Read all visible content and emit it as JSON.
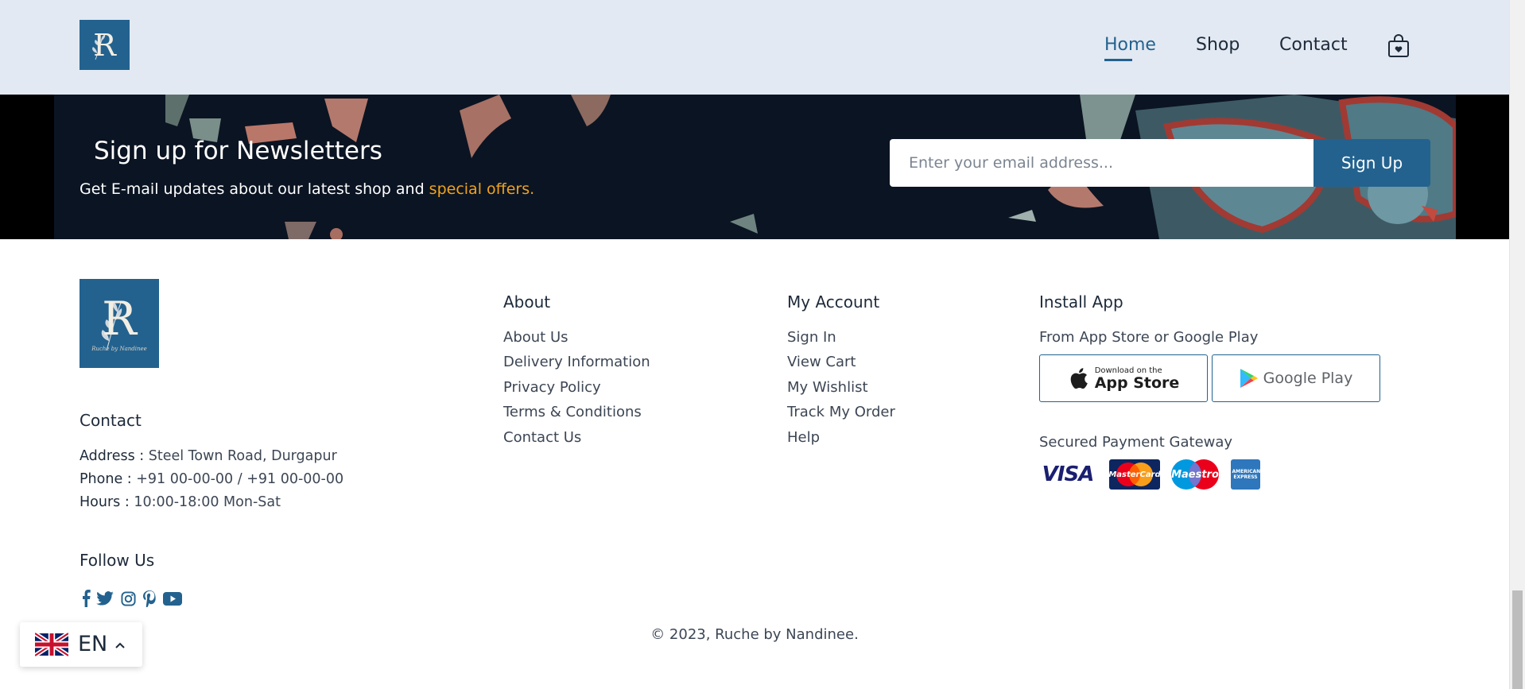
{
  "brand": {
    "logo_letter": "R",
    "logo_caption": "Ruche by Nandinee"
  },
  "nav": {
    "items": [
      "Home",
      "Shop",
      "Contact"
    ],
    "active": "Home"
  },
  "newsletter": {
    "title": "Sign up for Newsletters",
    "subtitle_prefix": "Get E-mail updates about our latest shop and ",
    "subtitle_highlight": "special offers.",
    "email_placeholder": "Enter your email address...",
    "button": "Sign Up"
  },
  "footer": {
    "contact": {
      "heading": "Contact",
      "address_label": "Address :",
      "address": "Steel Town Road, Durgapur",
      "phone_label": "Phone :",
      "phone": "+91 00-00-00 / +91 00-00-00",
      "hours_label": "Hours :",
      "hours": "10:00-18:00 Mon-Sat"
    },
    "follow": {
      "heading": "Follow Us",
      "icons": [
        "facebook-icon",
        "twitter-icon",
        "instagram-icon",
        "pinterest-icon",
        "youtube-icon"
      ]
    },
    "about": {
      "heading": "About",
      "links": [
        "About Us",
        "Delivery Information",
        "Privacy Policy",
        "Terms & Conditions",
        "Contact Us"
      ]
    },
    "account": {
      "heading": "My Account",
      "links": [
        "Sign In",
        "View Cart",
        "My Wishlist",
        "Track My Order",
        "Help"
      ]
    },
    "app": {
      "heading": "Install App",
      "subtitle": "From App Store or Google Play",
      "app_store_small": "Download on the",
      "app_store_big": "App Store",
      "google_play": "Google Play",
      "payment_heading": "Secured Payment Gateway",
      "payments": [
        "VISA",
        "MasterCard",
        "Maestro",
        "AMERICAN EXPRESS"
      ]
    },
    "copyright": "© 2023, Ruche by Nandinee."
  },
  "language": {
    "code": "EN"
  },
  "colors": {
    "primary": "#23628f",
    "header_bg": "#e2e9f2",
    "highlight": "#f0a31d"
  }
}
